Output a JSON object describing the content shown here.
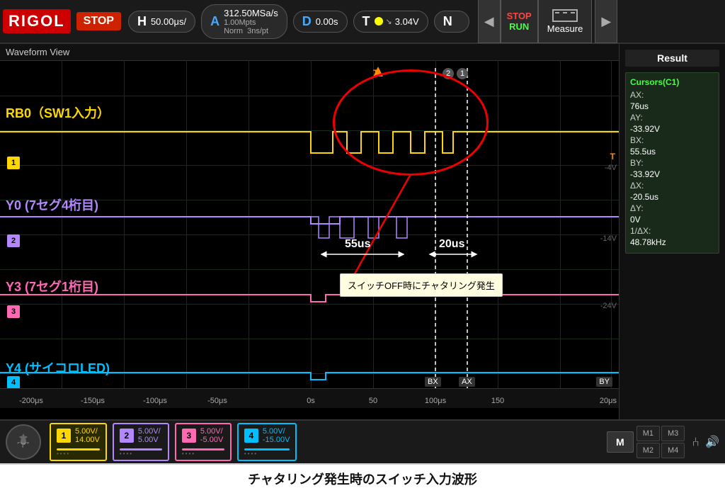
{
  "header": {
    "logo": "RIGOL",
    "stop_label": "STOP",
    "h_label": "H",
    "h_value": "50.00μs/",
    "a_label": "A",
    "a_sample": "312.50MSa/s",
    "a_points": "1.00Mpts",
    "a_norm": "Norm",
    "a_ns": "3ns/pt",
    "d_label": "D",
    "d_value": "0.00s",
    "t_label": "T",
    "t_voltage": "3.04V",
    "n_label": "N",
    "stop_run_stop": "STOP",
    "stop_run_run": "RUN",
    "measure_label": "Measure"
  },
  "waveform": {
    "title": "Waveform View",
    "ch1_label": "RB0（SW1入力）",
    "ch2_label": "Y0 (7セグ4桁目)",
    "ch3_label": "Y3 (7セグ1桁目)",
    "ch4_label": "Y4 (サイコロLED)",
    "annotation_text": "スイッチOFF時にチャタリング発生",
    "time_55": "55us",
    "time_20": "20us",
    "volt_markers": [
      "-4V",
      "-14V",
      "-24V"
    ],
    "time_ticks": [
      "-200μs",
      "-150μs",
      "-100μs",
      "-50μs",
      "0s",
      "50",
      "100μs",
      "150"
    ]
  },
  "result_panel": {
    "title": "Result",
    "cursor_title": "Cursors(C1)",
    "ax_label": "AX:",
    "ax_value": "76us",
    "ay_label": "AY:",
    "ay_value": "-33.92V",
    "bx_label": "BX:",
    "bx_value": "55.5us",
    "by_label": "BY:",
    "by_value": "-33.92V",
    "dx_label": "ΔX:",
    "dx_value": "-20.5us",
    "dy_label": "ΔY:",
    "dy_value": "0V",
    "inv_dx_label": "1/ΔX:",
    "inv_dx_value": "48.78kHz"
  },
  "bottom": {
    "ch1_num": "1",
    "ch1_v1": "5.00V/",
    "ch1_v2": "14.00V",
    "ch2_num": "2",
    "ch2_v1": "5.00V/",
    "ch2_v2": "5.00V",
    "ch3_num": "3",
    "ch3_v1": "5.00V/",
    "ch3_v2": "-5.00V",
    "ch4_num": "4",
    "ch4_v1": "5.00V/",
    "ch4_v2": "-15.00V",
    "m_label": "M",
    "m1_label": "M1",
    "m2_label": "M2",
    "m3_label": "M3",
    "m4_label": "M4"
  },
  "caption": {
    "text": "チャタリング発生時のスイッチ入力波形"
  }
}
